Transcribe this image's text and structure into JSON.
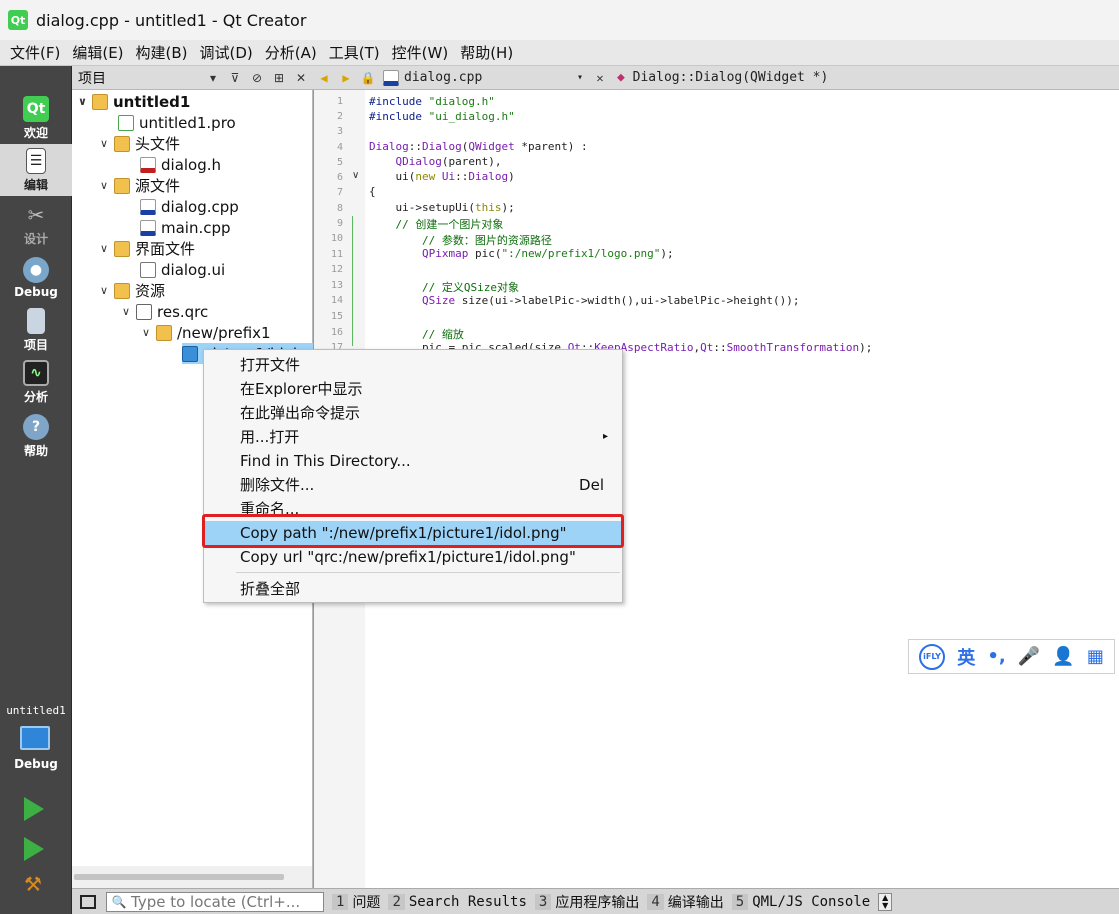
{
  "window": {
    "title": "dialog.cpp - untitled1 - Qt Creator",
    "logo": "Qt"
  },
  "menubar": [
    "文件(F)",
    "编辑(E)",
    "构建(B)",
    "调试(D)",
    "分析(A)",
    "工具(T)",
    "控件(W)",
    "帮助(H)"
  ],
  "modes": [
    {
      "label": "欢迎",
      "icon": "qt-welcome-icon",
      "active": false
    },
    {
      "label": "编辑",
      "icon": "edit-document-icon",
      "active": true
    },
    {
      "label": "设计",
      "icon": "design-tools-icon",
      "active": false
    },
    {
      "label": "Debug",
      "icon": "debug-bug-icon",
      "active": false
    },
    {
      "label": "项目",
      "icon": "projects-icon",
      "active": false
    },
    {
      "label": "分析",
      "icon": "analyze-icon",
      "active": false
    },
    {
      "label": "帮助",
      "icon": "help-icon",
      "active": false
    }
  ],
  "kit": {
    "project": "untitled1",
    "config": "Debug"
  },
  "project_pane": {
    "title": "项目"
  },
  "tree": {
    "root": "untitled1",
    "pro": "untitled1.pro",
    "headers": "头文件",
    "dialog_h": "dialog.h",
    "sources": "源文件",
    "dialog_cpp": "dialog.cpp",
    "main_cpp": "main.cpp",
    "forms": "界面文件",
    "dialog_ui": "dialog.ui",
    "resources": "资源",
    "res_qrc": "res.qrc",
    "prefix": "/new/prefix1",
    "selected_file": "picture1/idol"
  },
  "editor": {
    "filename": "dialog.cpp",
    "function": "Dialog::Dialog(QWidget *)",
    "line_numbers": [
      "1",
      "2",
      "3",
      "4",
      "5",
      "6",
      "7",
      "8",
      "9",
      "10",
      "11",
      "12",
      "13",
      "14",
      "15",
      "16",
      "17"
    ]
  },
  "context_menu": {
    "items": [
      {
        "label": "打开文件"
      },
      {
        "label": "在Explorer中显示"
      },
      {
        "label": "在此弹出命令提示"
      },
      {
        "label": "用...打开",
        "submenu": "▸"
      },
      {
        "label": "Find in This Directory..."
      },
      {
        "label": "删除文件...",
        "shortcut": "Del"
      },
      {
        "label": "重命名..."
      },
      {
        "label": "Copy path \":/new/prefix1/picture1/idol.png\""
      },
      {
        "label": "Copy url \"qrc:/new/prefix1/picture1/idol.png\""
      },
      {
        "label": "折叠全部"
      }
    ]
  },
  "ime": {
    "brand": "iFLY",
    "lang": "英"
  },
  "bottombar": {
    "locator_placeholder": "Type to locate (Ctrl+...",
    "tabs": [
      {
        "num": "1",
        "label": "问题"
      },
      {
        "num": "2",
        "label": "Search Results"
      },
      {
        "num": "3",
        "label": "应用程序输出"
      },
      {
        "num": "4",
        "label": "编译输出"
      },
      {
        "num": "5",
        "label": "QML/JS Console"
      }
    ]
  }
}
